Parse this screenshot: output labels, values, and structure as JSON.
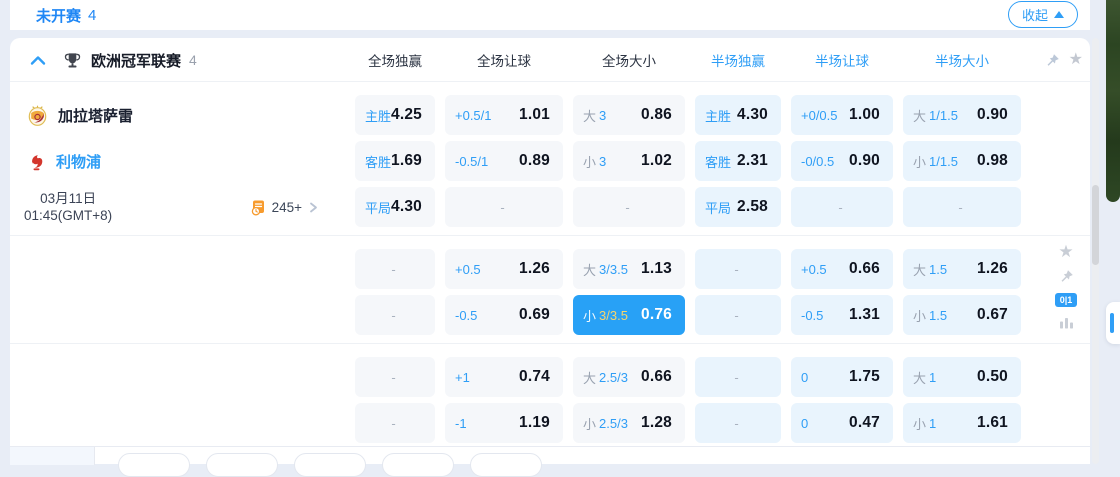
{
  "topbar": {
    "title": "未开赛",
    "count": "4",
    "collapse": "收起"
  },
  "league": {
    "name": "欧洲冠军联赛",
    "count": "4"
  },
  "header": {
    "columns": [
      "全场独赢",
      "全场让球",
      "全场大小",
      "半场独赢",
      "半场让球",
      "半场大小"
    ]
  },
  "match": {
    "home": "加拉塔萨雷",
    "away": "利物浦",
    "date": "03月11日",
    "time": "01:45(GMT+8)",
    "markets": "245+"
  },
  "sidebar": {
    "badge": "0|1"
  },
  "odds": {
    "groups": [
      {
        "rows": [
          {
            "cells": [
              {
                "label": "主胜",
                "value": "4.25"
              },
              {
                "label": "+0.5/1",
                "value": "1.01"
              },
              {
                "prefix": "大",
                "handicap": "3",
                "value": "0.86"
              },
              {
                "label": "主胜",
                "value": "4.30"
              },
              {
                "label": "+0/0.5",
                "value": "1.00"
              },
              {
                "prefix": "大",
                "handicap": "1/1.5",
                "value": "0.90"
              }
            ]
          },
          {
            "cells": [
              {
                "label": "客胜",
                "value": "1.69"
              },
              {
                "label": "-0.5/1",
                "value": "0.89"
              },
              {
                "prefix": "小",
                "handicap": "3",
                "value": "1.02"
              },
              {
                "label": "客胜",
                "value": "2.31"
              },
              {
                "label": "-0/0.5",
                "value": "0.90"
              },
              {
                "prefix": "小",
                "handicap": "1/1.5",
                "value": "0.98"
              }
            ]
          },
          {
            "cells": [
              {
                "label": "平局",
                "value": "4.30"
              },
              {
                "dash": true
              },
              {
                "dash": true
              },
              {
                "label": "平局",
                "value": "2.58"
              },
              {
                "dash": true
              },
              {
                "dash": true
              }
            ]
          }
        ]
      },
      {
        "rows": [
          {
            "cells": [
              {
                "dash": true
              },
              {
                "label": "+0.5",
                "value": "1.26"
              },
              {
                "prefix": "大",
                "handicap": "3/3.5",
                "value": "1.13"
              },
              {
                "dash": true
              },
              {
                "label": "+0.5",
                "value": "0.66"
              },
              {
                "prefix": "大",
                "handicap": "1.5",
                "value": "1.26"
              }
            ]
          },
          {
            "cells": [
              {
                "dash": true
              },
              {
                "label": "-0.5",
                "value": "0.69"
              },
              {
                "prefix": "小",
                "handicap": "3/3.5",
                "value": "0.76",
                "highlight": true
              },
              {
                "dash": true
              },
              {
                "label": "-0.5",
                "value": "1.31"
              },
              {
                "prefix": "小",
                "handicap": "1.5",
                "value": "0.67"
              }
            ]
          }
        ]
      },
      {
        "rows": [
          {
            "cells": [
              {
                "dash": true
              },
              {
                "label": "+1",
                "value": "0.74"
              },
              {
                "prefix": "大",
                "handicap": "2.5/3",
                "value": "0.66"
              },
              {
                "dash": true
              },
              {
                "label": "0",
                "value": "1.75"
              },
              {
                "prefix": "大",
                "handicap": "1",
                "value": "0.50"
              }
            ]
          },
          {
            "cells": [
              {
                "dash": true
              },
              {
                "label": "-1",
                "value": "1.19"
              },
              {
                "prefix": "小",
                "handicap": "2.5/3",
                "value": "1.28"
              },
              {
                "dash": true
              },
              {
                "label": "0",
                "value": "0.47"
              },
              {
                "prefix": "小",
                "handicap": "1",
                "value": "1.61"
              }
            ]
          }
        ]
      }
    ]
  },
  "icons": {
    "collapse": "triangle-up",
    "league_header": "trophy-icon",
    "expand_state": "chevron-up-icon",
    "favorite": "star-icon",
    "pin": "pushpin-icon",
    "markets": "doc-clock-icon",
    "markets_more": "chevron-right-icon",
    "stats": "bar-chart-icon"
  },
  "colors": {
    "accent_blue": "#2f9ef6",
    "title_blue": "#1f87f5",
    "value_dark": "#0f1420",
    "cell_full_bg": "#f5f7fa",
    "cell_half_bg": "#e9f4fd",
    "highlight_bg": "#28a1f6",
    "highlight_handicap": "#f7d56e",
    "markets_orange": "#f79b2e",
    "dash_gray": "#a9b2bf"
  }
}
